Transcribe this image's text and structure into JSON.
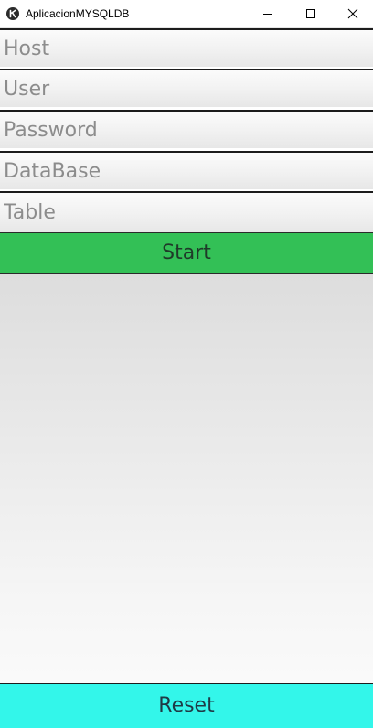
{
  "window": {
    "title": "AplicacionMYSQLDB",
    "controls": {
      "minimize_icon": "minimize-icon",
      "maximize_icon": "maximize-icon",
      "close_icon": "close-icon"
    }
  },
  "form": {
    "host": {
      "placeholder": "Host",
      "value": ""
    },
    "user": {
      "placeholder": "User",
      "value": ""
    },
    "password": {
      "placeholder": "Password",
      "value": ""
    },
    "database": {
      "placeholder": "DataBase",
      "value": ""
    },
    "table": {
      "placeholder": "Table",
      "value": ""
    }
  },
  "buttons": {
    "start_label": "Start",
    "reset_label": "Reset"
  },
  "colors": {
    "start_bg": "#33c056",
    "reset_bg": "#33f6ea",
    "field_border": "#1c1c1c"
  }
}
